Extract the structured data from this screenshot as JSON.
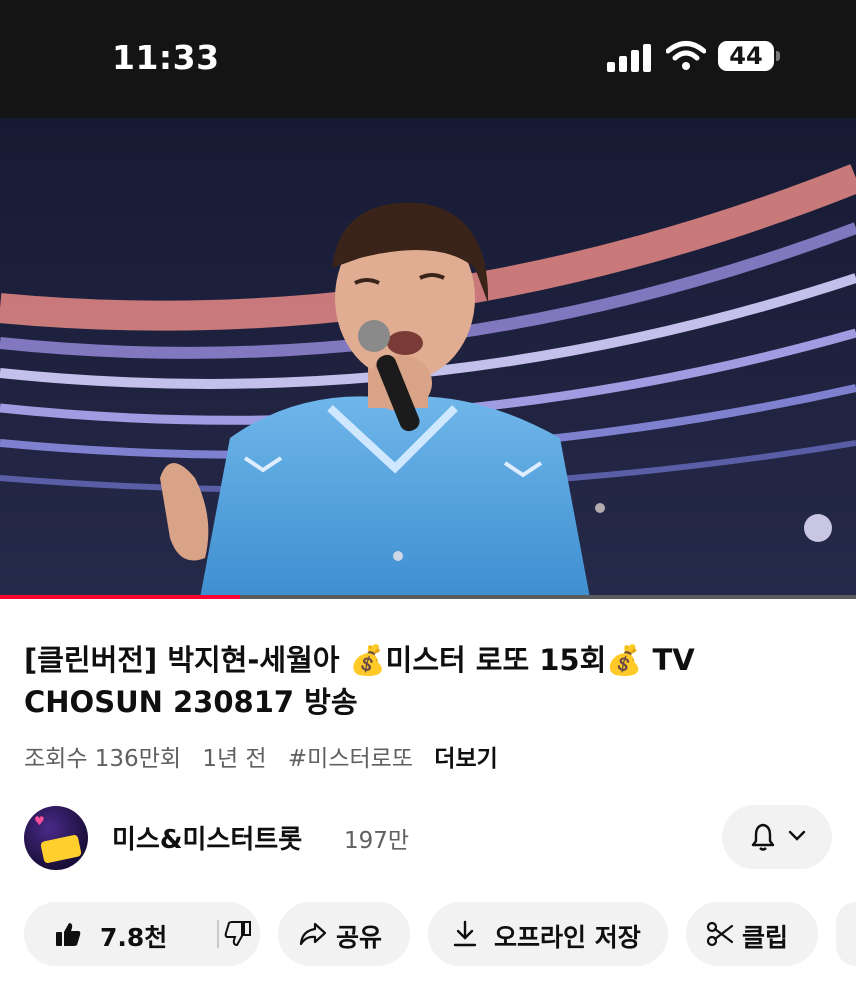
{
  "status": {
    "time": "11:33",
    "battery": "44"
  },
  "player": {
    "progress": 0.28
  },
  "video": {
    "title": "[클린버전] 박지현-세월아 💰미스터 로또 15회💰 TV CHOSUN 230817 방송",
    "views": "조회수 136만회",
    "age": "1년 전",
    "hashtag": "#미스터로또",
    "more": "더보기"
  },
  "channel": {
    "name": "미스&미스터트롯",
    "subscribers": "197만"
  },
  "actions": {
    "likes": "7.8천",
    "share": "공유",
    "offline": "오프라인 저장",
    "clip": "클립"
  },
  "icons": [
    "signal-icon",
    "wifi-icon",
    "bell-icon",
    "chevron-down-icon",
    "thumbs-up-icon",
    "thumbs-down-icon",
    "share-icon",
    "download-icon",
    "scissors-icon"
  ],
  "colors": {
    "accent": "#ff0033",
    "pill": "#f2f2f2",
    "statusbar": "#141414"
  }
}
